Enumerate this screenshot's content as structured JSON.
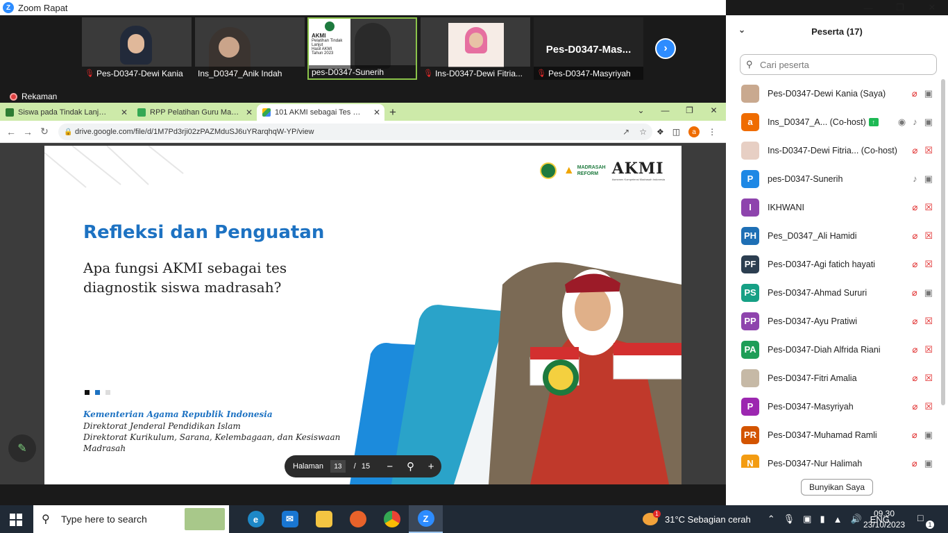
{
  "zoom": {
    "window_title": "Zoom Rapat",
    "recording_label": "Rekaman",
    "videos": [
      {
        "name": "Pes-D0347-Dewi Kania",
        "muted": true,
        "bg": "#c9c2b8"
      },
      {
        "name": "Ins_D0347_Anik Indah",
        "muted": false,
        "bg": "#c8c8c8"
      },
      {
        "name": "pes-D0347-Sunerih",
        "muted": false,
        "bg": "#d8d4cc"
      },
      {
        "name": "Ins-D0347-Dewi Fitria...",
        "muted": true,
        "bg": "#efd9cf"
      },
      {
        "name": "Pes-D0347-Masyriyah",
        "muted": true,
        "bg": "#232323"
      }
    ],
    "text_tile_name": "Pes-D0347-Mas...",
    "sunerih_slide_lines": [
      "AKMI",
      "Pelatihan Tindak Lanjut",
      "Hasil AKMI",
      "Tahun 2023"
    ]
  },
  "browser": {
    "tabs": [
      {
        "title": "Siswa pada Tindak Lanjut AKMI",
        "fav_color": "#2e7d32"
      },
      {
        "title": "RPP Pelatihan Guru Madrasah Ti",
        "fav_color": "#34a853"
      },
      {
        "title": "101 AKMI sebagai Tes Diagnosis",
        "fav_color": "#4285f4"
      }
    ],
    "url": "drive.google.com/file/d/1M7Pd3rji02zPAZMduSJ6uYRarqhqW-YP/view",
    "profile_letter": "a"
  },
  "slide": {
    "title": "Refleksi dan Penguatan",
    "question": "Apa fungsi AKMI sebagai tes diagnostik siswa madrasah?",
    "institution": "Kementerian Agama Republik Indonesia",
    "line1": "Direktorat Jenderal Pendidikan Islam",
    "line2": "Direktorat Kurikulum, Sarana, Kelembagaan, dan Kesiswaan",
    "line3": "Madrasah",
    "akmi_logo": "AKMI",
    "akmi_tagline": "Asesmen Kompetensi Madrasah Indonesia",
    "reform_logo": "MADRASAH REFORM"
  },
  "pager": {
    "label": "Halaman",
    "current": "13",
    "separator": "/",
    "total": "15"
  },
  "panel": {
    "title": "Peserta (17)",
    "search_placeholder": "Cari peserta",
    "bottom_button": "Bunyikan Saya",
    "participants": [
      {
        "initials": "",
        "name": "Pes-D0347-Dewi Kania (Saya)",
        "color": "#c9a98f",
        "mic": "off",
        "cam": "on"
      },
      {
        "initials": "a",
        "name": "Ins_D0347_A...  (Co-host)",
        "color": "#ef6c00",
        "mic": "on",
        "cam": "on",
        "sharing": true
      },
      {
        "initials": "",
        "name": "Ins-D0347-Dewi Fitria...  (Co-host)",
        "color": "#e7cfc4",
        "mic": "off",
        "cam": "off"
      },
      {
        "initials": "P",
        "name": "pes-D0347-Sunerih",
        "color": "#1e88e5",
        "mic": "on",
        "cam": "on"
      },
      {
        "initials": "I",
        "name": "IKHWANI",
        "color": "#8e44ad",
        "mic": "off",
        "cam": "off"
      },
      {
        "initials": "PH",
        "name": "Pes_D0347_Ali Hamidi",
        "color": "#1e6fb5",
        "mic": "off",
        "cam": "off"
      },
      {
        "initials": "PF",
        "name": "Pes-D0347-Agi fatich hayati",
        "color": "#2c3e50",
        "mic": "off",
        "cam": "off"
      },
      {
        "initials": "PS",
        "name": "Pes-D0347-Ahmad Sururi",
        "color": "#16a085",
        "mic": "off",
        "cam": "on"
      },
      {
        "initials": "PP",
        "name": "Pes-D0347-Ayu Pratiwi",
        "color": "#8e44ad",
        "mic": "off",
        "cam": "off"
      },
      {
        "initials": "PA",
        "name": "Pes-D0347-Diah Alfrida Riani",
        "color": "#1e9e57",
        "mic": "off",
        "cam": "off"
      },
      {
        "initials": "",
        "name": "Pes-D0347-Fitri Amalia",
        "color": "#c6b9a6",
        "mic": "off",
        "cam": "off"
      },
      {
        "initials": "P",
        "name": "Pes-D0347-Masyriyah",
        "color": "#9c27b0",
        "mic": "off",
        "cam": "off"
      },
      {
        "initials": "PR",
        "name": "Pes-D0347-Muhamad Ramli",
        "color": "#d35400",
        "mic": "off",
        "cam": "on"
      },
      {
        "initials": "N",
        "name": "Pes-D0347-Nur Halimah",
        "color": "#f39c12",
        "mic": "off",
        "cam": "on"
      }
    ]
  },
  "taskbar": {
    "search_placeholder": "Type here to search",
    "weather": "31°C  Sebagian cerah",
    "weather_badge": "1",
    "lang": "ENG",
    "time": "09.30",
    "date": "23/10/2023",
    "notif_count": "1"
  }
}
